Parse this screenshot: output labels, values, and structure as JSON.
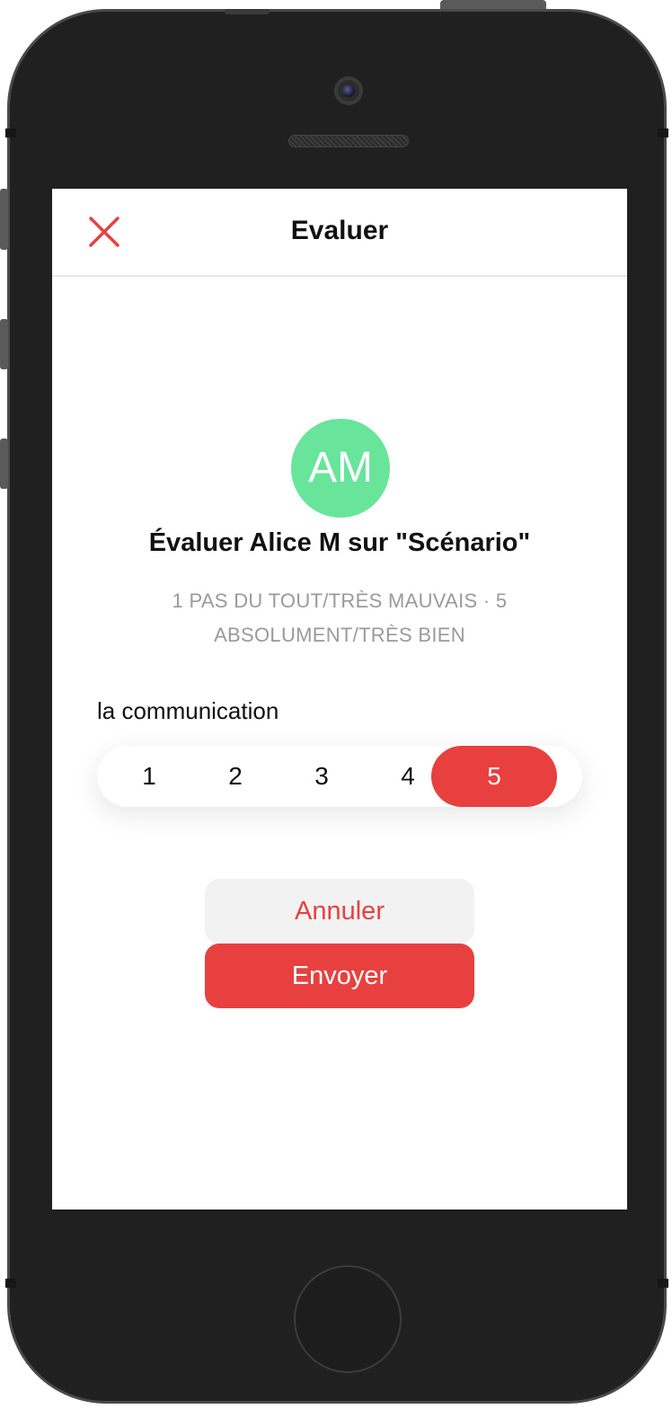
{
  "header": {
    "title": "Evaluer",
    "close_icon": "close-icon"
  },
  "profile": {
    "initials": "AM",
    "avatar_color": "#69e49b"
  },
  "evaluation": {
    "title": "Évaluer Alice M sur \"Scénario\"",
    "scale_hint_line1": "1 PAS DU TOUT/TRÈS MAUVAIS · 5",
    "scale_hint_line2": "ABSOLUMENT/TRÈS BIEN"
  },
  "criterion": {
    "label": "la communication",
    "options": [
      "1",
      "2",
      "3",
      "4",
      "5"
    ],
    "selected": "5"
  },
  "actions": {
    "cancel_label": "Annuler",
    "send_label": "Envoyer"
  },
  "colors": {
    "accent": "#e8403f",
    "avatar": "#69e49b",
    "muted_text": "#9a9a9a"
  }
}
